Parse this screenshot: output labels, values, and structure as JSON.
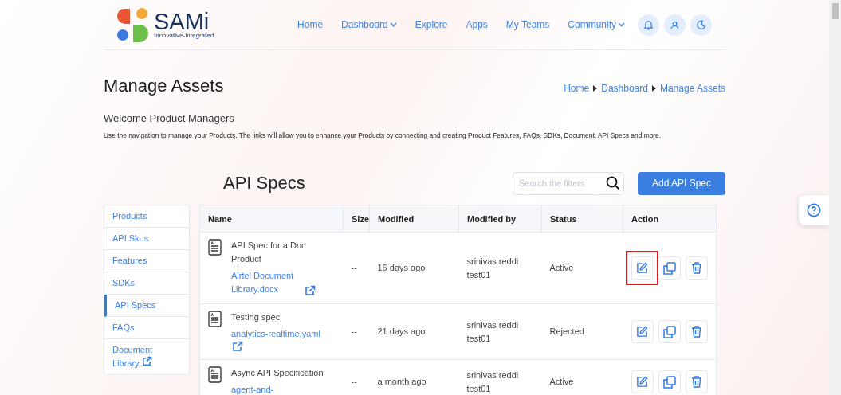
{
  "header": {
    "logo": {
      "name": "SAMi",
      "tagline": "Innovative-Integrated"
    },
    "nav": [
      {
        "label": "Home",
        "dropdown": false
      },
      {
        "label": "Dashboard",
        "dropdown": true
      },
      {
        "label": "Explore",
        "dropdown": false
      },
      {
        "label": "Apps",
        "dropdown": false
      },
      {
        "label": "My Teams",
        "dropdown": false
      },
      {
        "label": "Community",
        "dropdown": true
      }
    ]
  },
  "page": {
    "title": "Manage Assets",
    "breadcrumb": [
      "Home",
      "Dashboard",
      "Manage Assets"
    ],
    "welcome": "Welcome Product Managers",
    "description": "Use the navigation to manage your Products. The links will allow you to enhance your Products by connecting and creating Product Features, FAQs, SDKs, Document, API Specs and more."
  },
  "sidebar": {
    "items": [
      {
        "label": "Products",
        "selected": false,
        "external": false
      },
      {
        "label": "API Skus",
        "selected": false,
        "external": false
      },
      {
        "label": "Features",
        "selected": false,
        "external": false
      },
      {
        "label": "SDKs",
        "selected": false,
        "external": false
      },
      {
        "label": "API Specs",
        "selected": true,
        "external": false
      },
      {
        "label": "FAQs",
        "selected": false,
        "external": false
      },
      {
        "label": "Document Library",
        "selected": false,
        "external": true
      }
    ]
  },
  "section": {
    "title": "API Specs",
    "search": {
      "placeholder": "Search the filters"
    },
    "add_button": "Add API Spec"
  },
  "table": {
    "columns": [
      "Name",
      "Size",
      "Modified",
      "Modified by",
      "Status",
      "Action"
    ],
    "rows": [
      {
        "name": "API Spec for a Doc Product",
        "link": "Airtel Document Library.docx",
        "link_icon": true,
        "size": "--",
        "modified": "16 days ago",
        "modified_by": "srinivas reddi test01",
        "status": "Active",
        "edit_highlighted": true
      },
      {
        "name": "Testing spec",
        "link": "analytics-realtime.yaml",
        "link_icon": true,
        "size": "--",
        "modified": "21 days ago",
        "modified_by": "srinivas reddi test01",
        "status": "Rejected",
        "edit_highlighted": false
      },
      {
        "name": "Async API Specification",
        "link": "agent-and-",
        "link_icon": false,
        "size": "--",
        "modified": "a month ago",
        "modified_by": "srinivas reddi test01",
        "status": "Active",
        "edit_highlighted": false
      }
    ]
  }
}
